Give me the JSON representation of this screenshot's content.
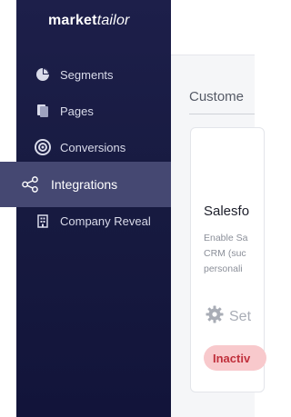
{
  "brand": {
    "logo_bold": "market",
    "logo_thin": "tailor"
  },
  "sidebar": {
    "items": [
      {
        "label": "Segments",
        "icon": "pie-chart-icon"
      },
      {
        "label": "Pages",
        "icon": "pages-icon"
      },
      {
        "label": "Conversions",
        "icon": "target-icon"
      },
      {
        "label": "Integrations",
        "icon": "share-nodes-icon",
        "active": true
      },
      {
        "label": "Company Reveal",
        "icon": "building-icon"
      }
    ]
  },
  "main": {
    "section_title": "Custome",
    "card": {
      "title": "Salesfo",
      "description_lines": [
        "Enable Sa",
        "CRM (suc",
        "personali"
      ],
      "setup_label": "Set",
      "status": "Inactiv"
    }
  },
  "colors": {
    "sidebar_bg": "#1d1f4a",
    "active_bg": "#454872",
    "status_bg": "#f8c9cc",
    "status_text": "#c0303c"
  }
}
